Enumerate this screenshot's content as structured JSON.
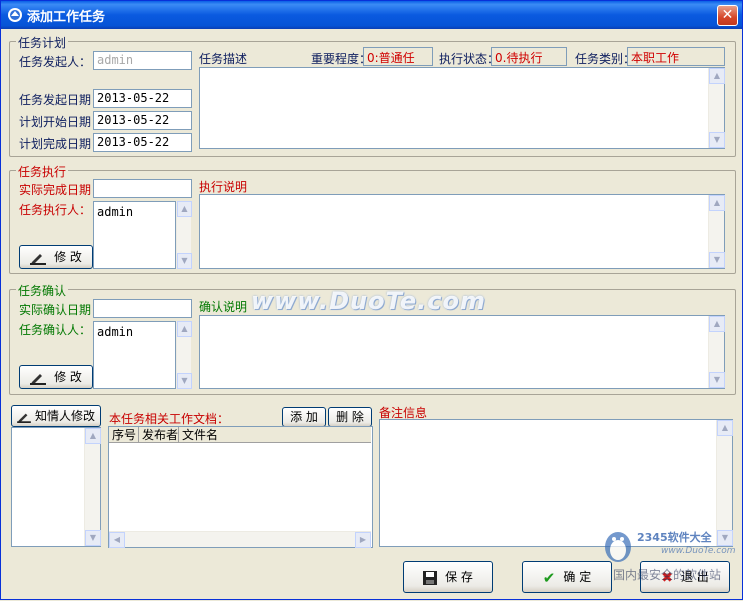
{
  "window": {
    "title": "添加工作任务",
    "close_glyph": "✕"
  },
  "plan": {
    "legend": "任务计划",
    "initiator_label": "任务发起人：",
    "initiator_value": "admin",
    "start_date_label": "任务发起日期：",
    "start_date_value": "2013-05-22",
    "plan_begin_label": "计划开始日期：",
    "plan_begin_value": "2013-05-22",
    "plan_end_label": "计划完成日期：",
    "plan_end_value": "2013-05-22",
    "desc_label": "任务描述",
    "importance_label": "重要程度：",
    "importance_value": "0:普通任",
    "exec_state_label": "执行状态：",
    "exec_state_value": "0.待执行",
    "category_label": "任务类别：",
    "category_value": "本职工作"
  },
  "execute": {
    "legend": "任务执行",
    "actual_done_label": "实际完成日期：",
    "actual_done_value": "",
    "executor_label": "任务执行人：",
    "executor_value": "admin",
    "note_label": "执行说明",
    "modify_label": "修 改"
  },
  "confirm": {
    "legend": "任务确认",
    "actual_confirm_label": "实际确认日期：",
    "actual_confirm_value": "",
    "confirmer_label": "任务确认人：",
    "confirmer_value": "admin",
    "note_label": "确认说明",
    "modify_label": "修 改"
  },
  "bottom": {
    "notify_button": "知情人修改",
    "docs_label": "本任务相关工作文档：",
    "add_button": "添 加",
    "delete_button": "删 除",
    "columns": [
      "序号",
      "发布者",
      "文件名"
    ],
    "remark_label": "备注信息"
  },
  "actions": {
    "save": "保  存",
    "ok": "确  定",
    "exit": "退  出"
  },
  "watermark": {
    "site": "www.DuoTe.com",
    "brand": "2345软件大全",
    "brand_url": "www.DuoTe.com",
    "slogan": "国内最安全的软件站"
  },
  "colors": {
    "title_bar": "#0A5AE0",
    "required_label": "#C80000",
    "optional_label": "#007800",
    "status_text": "#D00000"
  }
}
